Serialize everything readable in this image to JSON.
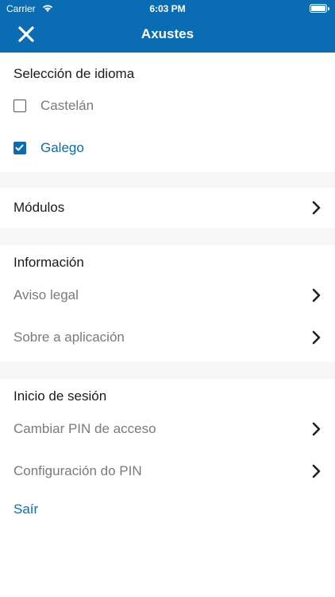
{
  "status_bar": {
    "carrier": "Carrier",
    "time": "6:03 PM"
  },
  "header": {
    "title": "Axustes"
  },
  "language": {
    "title": "Selección de idioma",
    "options": [
      {
        "label": "Castelán",
        "checked": false
      },
      {
        "label": "Galego",
        "checked": true
      }
    ]
  },
  "modules": {
    "label": "Módulos"
  },
  "info": {
    "title": "Información",
    "items": [
      {
        "label": "Aviso legal"
      },
      {
        "label": "Sobre a aplicación"
      }
    ]
  },
  "session": {
    "title": "Inicio de sesión",
    "items": [
      {
        "label": "Cambiar PIN de acceso"
      },
      {
        "label": "Configuración do PIN"
      }
    ],
    "logout_label": "Saír"
  },
  "colors": {
    "accent": "#0a6db4",
    "gap": "#f6f6f6",
    "muted_text": "#7a7a7a"
  },
  "icons": {
    "close": "close-icon",
    "chevron": "chevron-right-icon",
    "checkmark": "checkmark-icon",
    "wifi": "wifi-icon",
    "battery": "battery-icon"
  }
}
